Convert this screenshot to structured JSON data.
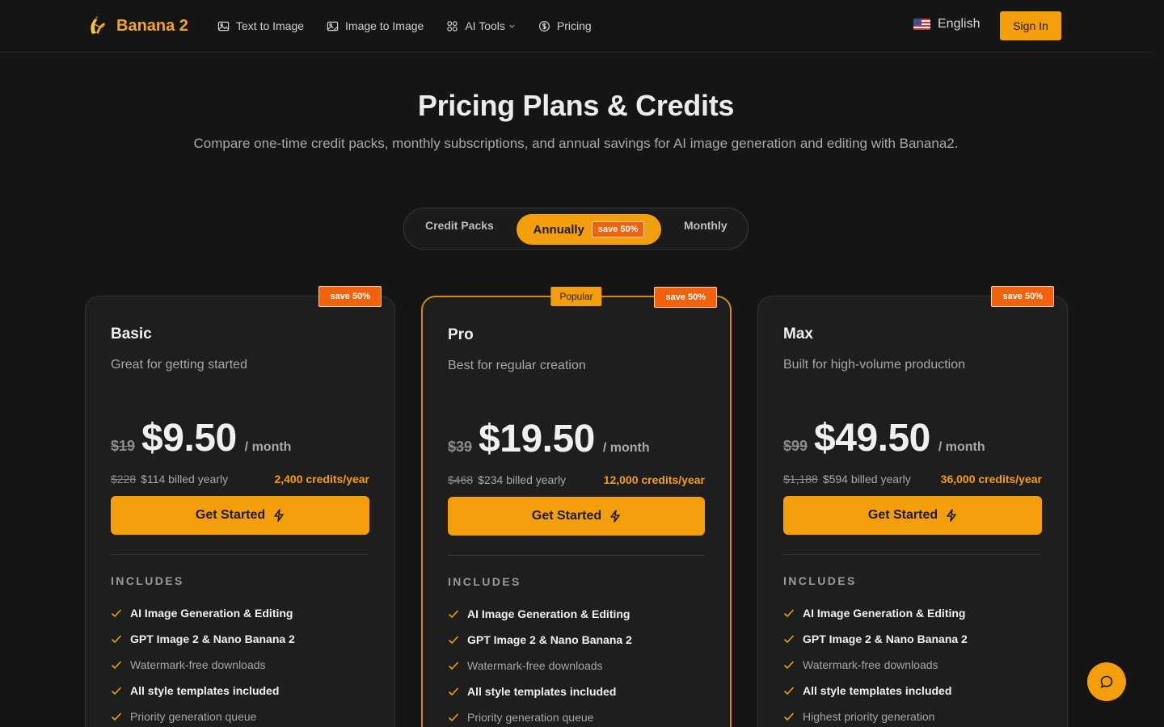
{
  "header": {
    "brand": "Banana 2",
    "nav": [
      {
        "label": "Text to Image",
        "icon": "image-icon"
      },
      {
        "label": "Image to Image",
        "icon": "image-edit-icon"
      },
      {
        "label": "AI Tools",
        "icon": "grid-icon"
      },
      {
        "label": "Pricing",
        "icon": "dollar-circle-icon"
      }
    ],
    "language": "English",
    "sign_in": "Sign In"
  },
  "hero": {
    "title": "Pricing Plans & Credits",
    "subtitle": "Compare one-time credit packs, monthly subscriptions, and annual savings for AI image generation and editing with Banana2."
  },
  "billing_toggle": {
    "credit_packs": "Credit Packs",
    "annually": "Annually",
    "annually_badge": "save 50%",
    "monthly": "Monthly",
    "selected": "Annually"
  },
  "plans": [
    {
      "name": "Basic",
      "description": "Great for getting started",
      "save_badge": "save 50%",
      "old_price": "$19",
      "price": "$9.50",
      "period": "/ month",
      "billed_old": "$228",
      "billed_new": "$114 billed yearly",
      "credits": "2,400 credits/year",
      "cta": "Get Started",
      "includes_label": "INCLUDES",
      "features": [
        {
          "text": "AI Image Generation & Editing",
          "emphasis": true
        },
        {
          "text": "GPT Image 2 & Nano Banana 2",
          "emphasis": true
        },
        {
          "text": "Watermark-free downloads",
          "emphasis": false
        },
        {
          "text": "All style templates included",
          "emphasis": true
        },
        {
          "text": "Priority generation queue",
          "emphasis": false
        }
      ]
    },
    {
      "name": "Pro",
      "description": "Best for regular creation",
      "popular_badge": "Popular",
      "save_badge": "save 50%",
      "old_price": "$39",
      "price": "$19.50",
      "period": "/ month",
      "billed_old": "$468",
      "billed_new": "$234 billed yearly",
      "credits": "12,000 credits/year",
      "cta": "Get Started",
      "includes_label": "INCLUDES",
      "features": [
        {
          "text": "AI Image Generation & Editing",
          "emphasis": true
        },
        {
          "text": "GPT Image 2 & Nano Banana 2",
          "emphasis": true
        },
        {
          "text": "Watermark-free downloads",
          "emphasis": false
        },
        {
          "text": "All style templates included",
          "emphasis": true
        },
        {
          "text": "Priority generation queue",
          "emphasis": false
        }
      ]
    },
    {
      "name": "Max",
      "description": "Built for high-volume production",
      "save_badge": "save 50%",
      "old_price": "$99",
      "price": "$49.50",
      "period": "/ month",
      "billed_old": "$1,188",
      "billed_new": "$594 billed yearly",
      "credits": "36,000 credits/year",
      "cta": "Get Started",
      "includes_label": "INCLUDES",
      "features": [
        {
          "text": "AI Image Generation & Editing",
          "emphasis": true
        },
        {
          "text": "GPT Image 2 & Nano Banana 2",
          "emphasis": true
        },
        {
          "text": "Watermark-free downloads",
          "emphasis": false
        },
        {
          "text": "All style templates included",
          "emphasis": true
        },
        {
          "text": "Highest priority generation",
          "emphasis": false
        }
      ]
    }
  ],
  "colors": {
    "accent": "#f59e0b",
    "save_badge": "#f2610c",
    "background": "#151515",
    "card": "#1e1e1e"
  },
  "chat_button": {
    "icon": "chat-bubble-icon"
  }
}
